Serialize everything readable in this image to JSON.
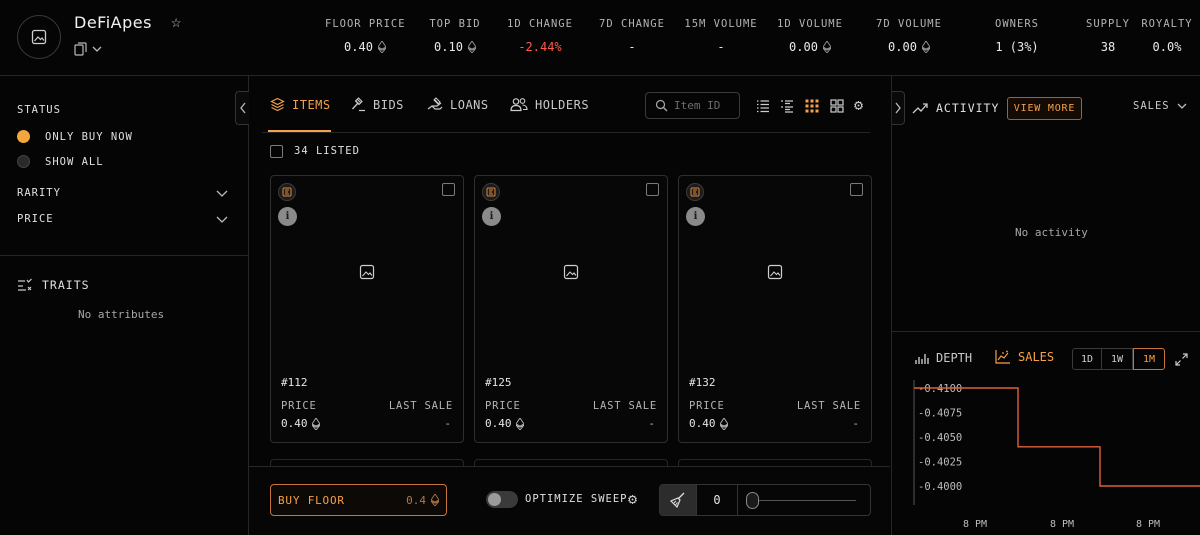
{
  "header": {
    "collection_name": "DeFiApes",
    "stats": [
      {
        "label": "FLOOR PRICE",
        "value": "0.40",
        "eth": true,
        "color": "#eaeaea"
      },
      {
        "label": "TOP BID",
        "value": "0.10",
        "eth": true,
        "color": "#eaeaea"
      },
      {
        "label": "1D CHANGE",
        "value": "-2.44%",
        "eth": false,
        "color": "#ff5a4a"
      },
      {
        "label": "7D CHANGE",
        "value": "-",
        "eth": false,
        "color": "#eaeaea"
      },
      {
        "label": "15M VOLUME",
        "value": "-",
        "eth": false,
        "color": "#eaeaea"
      },
      {
        "label": "1D VOLUME",
        "value": "0.00",
        "eth": true,
        "color": "#eaeaea"
      },
      {
        "label": "7D VOLUME",
        "value": "0.00",
        "eth": true,
        "color": "#eaeaea"
      },
      {
        "label": "OWNERS",
        "value": "1 (3%)",
        "eth": false,
        "color": "#eaeaea"
      },
      {
        "label": "SUPPLY",
        "value": "38",
        "eth": false,
        "color": "#eaeaea"
      },
      {
        "label": "ROYALTY",
        "value": "0.0%",
        "eth": false,
        "color": "#eaeaea"
      }
    ]
  },
  "sidebar": {
    "status_label": "STATUS",
    "only_buy_now": "ONLY BUY NOW",
    "show_all": "SHOW ALL",
    "rarity_label": "RARITY",
    "price_label": "PRICE",
    "traits_label": "TRAITS",
    "no_attributes": "No attributes"
  },
  "tabs": {
    "items": "ITEMS",
    "bids": "BIDS",
    "loans": "LOANS",
    "holders": "HOLDERS",
    "search_placeholder": "Item ID"
  },
  "listed": "34 LISTED",
  "cards": [
    {
      "number": "#112",
      "price_label": "PRICE",
      "last_sale_label": "LAST SALE",
      "price": "0.40",
      "last_sale": "-"
    },
    {
      "number": "#125",
      "price_label": "PRICE",
      "last_sale_label": "LAST SALE",
      "price": "0.40",
      "last_sale": "-"
    },
    {
      "number": "#132",
      "price_label": "PRICE",
      "last_sale_label": "LAST SALE",
      "price": "0.40",
      "last_sale": "-"
    }
  ],
  "bottom_bar": {
    "buy_floor_label": "BUY FLOOR",
    "buy_floor_value": "0.4",
    "optimize_sweep": "OPTIMIZE SWEEP",
    "sweep_count": "0"
  },
  "activity": {
    "title": "ACTIVITY",
    "view_more": "VIEW MORE",
    "filter": "SALES",
    "empty": "No activity"
  },
  "chart_panel": {
    "depth_tab": "DEPTH",
    "sales_tab": "SALES",
    "timeframes": [
      "1D",
      "1W",
      "1M"
    ],
    "active_timeframe": "1M"
  },
  "colors": {
    "accent": "#f5a04a",
    "negative": "#ff5a4a",
    "chart_line": "#e0603a"
  },
  "chart_data": {
    "type": "line",
    "title": "",
    "xlabel": "",
    "ylabel": "",
    "y_ticks": [
      "0.4100",
      "0.4075",
      "0.4050",
      "0.4025",
      "0.4000"
    ],
    "x_ticks": [
      "8 PM",
      "8 PM",
      "8 PM"
    ],
    "ylim": [
      0.4,
      0.41
    ],
    "step": true,
    "series": [
      {
        "values": [
          0.41,
          0.41,
          0.404,
          0.404,
          0.4,
          0.4
        ]
      }
    ]
  }
}
